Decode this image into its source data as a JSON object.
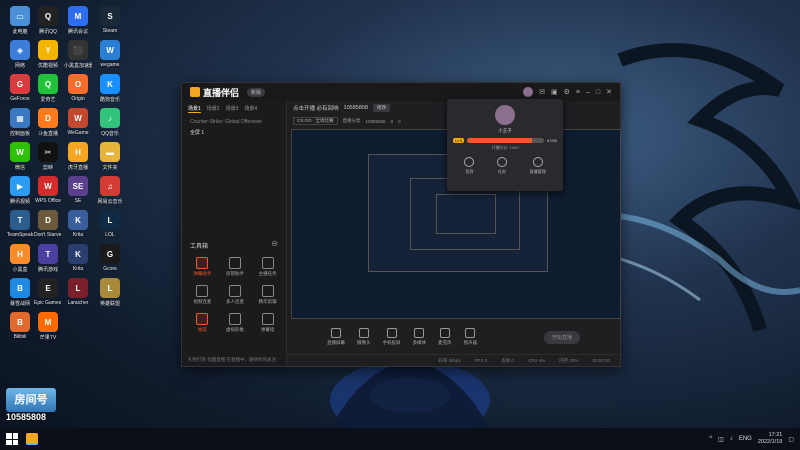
{
  "desktop_icons": [
    {
      "label": "此电脑",
      "glyph": "▭",
      "color": "#4a90d9"
    },
    {
      "label": "腾讯QQ",
      "glyph": "Q",
      "color": "#222"
    },
    {
      "label": "腾讯会议",
      "glyph": "M",
      "color": "#2e6ff2"
    },
    {
      "label": "Steam",
      "glyph": "S",
      "color": "#1b2838"
    },
    {
      "label": "网络",
      "glyph": "◈",
      "color": "#3b7dd8"
    },
    {
      "label": "优酷视频",
      "glyph": "Y",
      "color": "#f3b400"
    },
    {
      "label": "小黑盒加速器",
      "glyph": "⬛",
      "color": "#333"
    },
    {
      "label": "wegame",
      "glyph": "W",
      "color": "#2a7fd4"
    },
    {
      "label": "GeForce",
      "glyph": "G",
      "color": "#d83c3c"
    },
    {
      "label": "爱奇艺",
      "glyph": "Q",
      "color": "#1fc238"
    },
    {
      "label": "Origin",
      "glyph": "O",
      "color": "#f56c2d"
    },
    {
      "label": "酷狗音乐",
      "glyph": "K",
      "color": "#1890ff"
    },
    {
      "label": "控制面板",
      "glyph": "▦",
      "color": "#3a78c2"
    },
    {
      "label": "斗鱼直播",
      "glyph": "D",
      "color": "#ff7a1a"
    },
    {
      "label": "WeGame",
      "glyph": "W",
      "color": "#c4472f"
    },
    {
      "label": "QQ音乐",
      "glyph": "♪",
      "color": "#31c27c"
    },
    {
      "label": "微信",
      "glyph": "W",
      "color": "#2dc100"
    },
    {
      "label": "剪映",
      "glyph": "✂",
      "color": "#111"
    },
    {
      "label": "虎牙直播",
      "glyph": "H",
      "color": "#f5a623"
    },
    {
      "label": "文件夹",
      "glyph": "▬",
      "color": "#e8b53c"
    },
    {
      "label": "腾讯视频",
      "glyph": "▶",
      "color": "#2b9cf2"
    },
    {
      "label": "WPS Office",
      "glyph": "W",
      "color": "#d52b2b"
    },
    {
      "label": "SE",
      "glyph": "SE",
      "color": "#5b3f8c"
    },
    {
      "label": "网易云音乐",
      "glyph": "♫",
      "color": "#d43c33"
    },
    {
      "label": "TeamSpeak",
      "glyph": "T",
      "color": "#2b5d8f"
    },
    {
      "label": "Don't Starve Together",
      "glyph": "D",
      "color": "#6b5a3c"
    },
    {
      "label": "Krita",
      "glyph": "K",
      "color": "#3a5e9c"
    },
    {
      "label": "LOL",
      "glyph": "L",
      "color": "#0f2a44"
    },
    {
      "label": "小黑盒",
      "glyph": "H",
      "color": "#ff8c2a"
    },
    {
      "label": "腾讯游戏",
      "glyph": "T",
      "color": "#4b3fa0"
    },
    {
      "label": "Krita",
      "glyph": "K",
      "color": "#2c3e70"
    },
    {
      "label": "Gcore",
      "glyph": "G",
      "color": "#1a1a1a"
    },
    {
      "label": "暴雪战网",
      "glyph": "B",
      "color": "#1e88e5"
    },
    {
      "label": "Epic Games Launcher",
      "glyph": "E",
      "color": "#222"
    },
    {
      "label": "Lanucher",
      "glyph": "L",
      "color": "#7a1f2b"
    },
    {
      "label": "英雄联盟",
      "glyph": "L",
      "color": "#a88a3a"
    },
    {
      "label": "Bilibili",
      "glyph": "B",
      "color": "#e06a2c"
    },
    {
      "label": "芒果TV",
      "glyph": "M",
      "color": "#ff6a00"
    }
  ],
  "brand": {
    "logo": "房间号",
    "number": "10585808"
  },
  "app": {
    "name": "直播伴侣",
    "version": "新版",
    "scene_tabs": [
      "场景1",
      "场景2",
      "场景3",
      "场景4"
    ],
    "sources": [
      "Counter-Strike: Global Offensive",
      "全屏 1"
    ],
    "tools_title": "工具箱",
    "tools": [
      {
        "label": "弹幕助手",
        "hot": true
      },
      {
        "label": "房管助手",
        "hot": false
      },
      {
        "label": "主播任务",
        "hot": false
      },
      {
        "label": "视频连麦",
        "hot": false
      },
      {
        "label": "多人连麦",
        "hot": false
      },
      {
        "label": "精华剪辑",
        "hot": false
      },
      {
        "label": "福袋",
        "hot": true
      },
      {
        "label": "虚拟形象",
        "hot": false
      },
      {
        "label": "弹幕墙",
        "hot": false
      }
    ],
    "left_footer": "礼物打赏 优酷直播 在直播中，期待你的关注",
    "room_title": "点击开播 必有回响",
    "room_id": "10585808",
    "room_chip": "修改",
    "game_select": "CS:GO · 全场比赛",
    "game_info": [
      "直播分类",
      "10585808",
      "0",
      "0"
    ],
    "bottom_items": [
      "直播屏幕",
      "摄像头",
      "手机投屏",
      "多媒体",
      "麦克风",
      "扬声器"
    ],
    "go_live": "开始直播",
    "status": [
      "码率 0kbps",
      "FPS 0",
      "丢帧 0",
      "CPU 4%",
      "内存 33%",
      "00:00:00"
    ]
  },
  "popup": {
    "name": "小王子",
    "level": "Lv.5",
    "progress": 0.85,
    "progress_text": "67/80",
    "time": "开播时长: 1969",
    "actions": [
      "签到",
      "任务",
      "直播管理"
    ]
  },
  "taskbar": {
    "lang": "ENG",
    "time": "17:21",
    "date": "2022/1/19"
  }
}
